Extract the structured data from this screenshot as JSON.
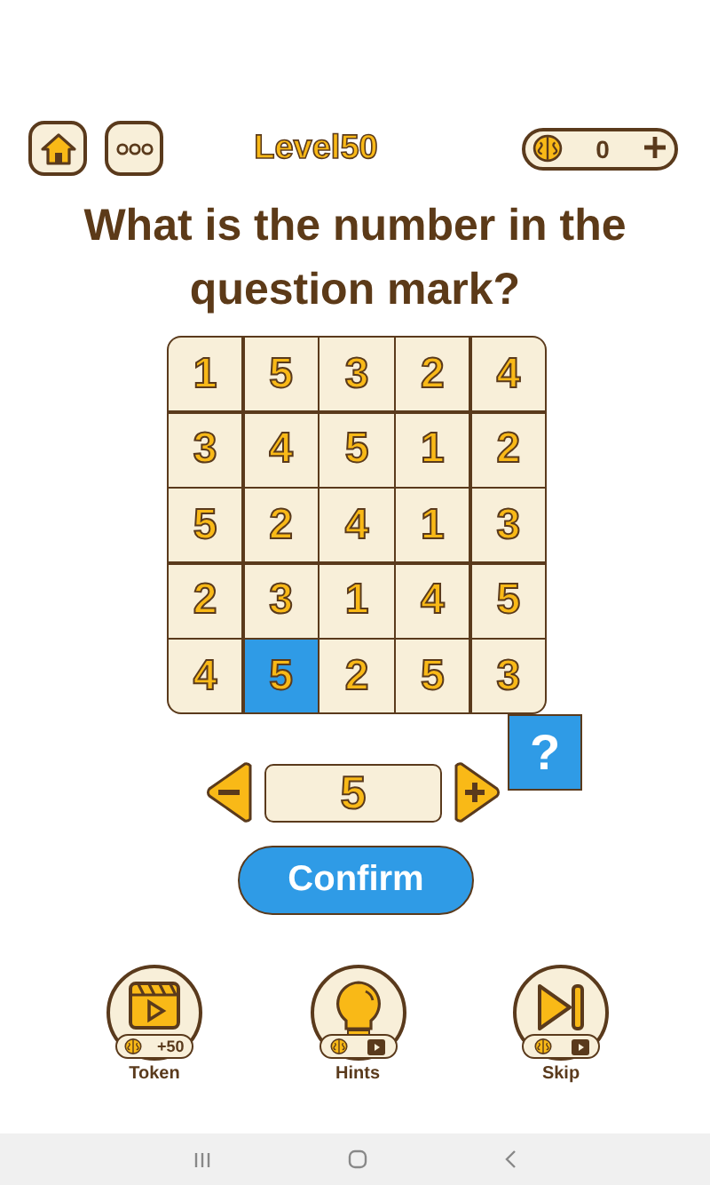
{
  "top_bar": {
    "level_title": "Level50",
    "coins": "0"
  },
  "question": "What is the number in the question mark?",
  "grid": [
    [
      {
        "value": "1",
        "selected": false
      },
      {
        "value": "5",
        "selected": false
      },
      {
        "value": "3",
        "selected": false
      },
      {
        "value": "2",
        "selected": false
      },
      {
        "value": "4",
        "selected": false
      }
    ],
    [
      {
        "value": "3",
        "selected": false
      },
      {
        "value": "4",
        "selected": false
      },
      {
        "value": "5",
        "selected": false
      },
      {
        "value": "1",
        "selected": false
      },
      {
        "value": "2",
        "selected": false
      }
    ],
    [
      {
        "value": "5",
        "selected": false
      },
      {
        "value": "2",
        "selected": false
      },
      {
        "value": "4",
        "selected": false
      },
      {
        "value": "1",
        "selected": false
      },
      {
        "value": "3",
        "selected": false
      }
    ],
    [
      {
        "value": "2",
        "selected": false
      },
      {
        "value": "3",
        "selected": false
      },
      {
        "value": "1",
        "selected": false
      },
      {
        "value": "4",
        "selected": false
      },
      {
        "value": "5",
        "selected": false
      }
    ],
    [
      {
        "value": "4",
        "selected": false
      },
      {
        "value": "5",
        "selected": true
      },
      {
        "value": "2",
        "selected": false
      },
      {
        "value": "5",
        "selected": false
      },
      {
        "value": "3",
        "selected": false
      }
    ]
  ],
  "question_mark": "?",
  "answer": {
    "value": "5"
  },
  "confirm": "Confirm",
  "powerups": [
    {
      "kind": "token",
      "label": "Token",
      "reward": "+50"
    },
    {
      "kind": "hints",
      "label": "Hints"
    },
    {
      "kind": "skip",
      "label": "Skip"
    }
  ]
}
